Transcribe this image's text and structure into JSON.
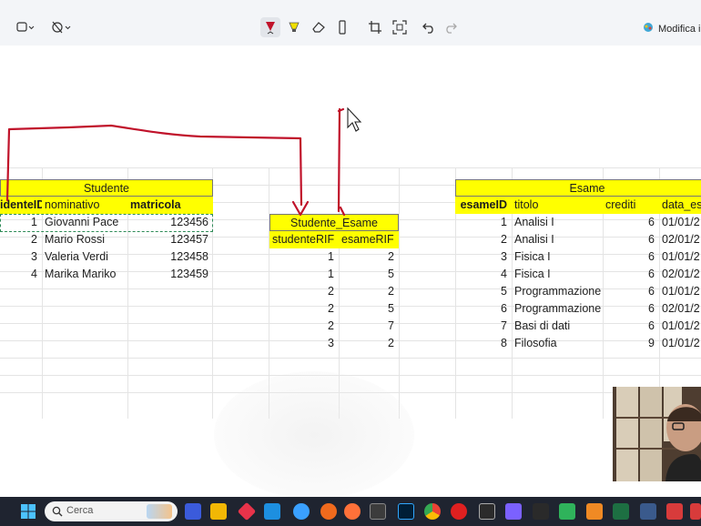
{
  "toolbar": {
    "modifica_label": "Modifica in",
    "tools": [
      "shape-icon",
      "timer-off-icon",
      "pen-icon",
      "highlighter-icon",
      "eraser-icon",
      "ruler-icon",
      "crop-icon",
      "text-extract-icon",
      "undo-icon",
      "redo-icon"
    ]
  },
  "studente": {
    "title": "Studente",
    "headers": [
      "identeID",
      "nominativo",
      "matricola"
    ],
    "rows": [
      {
        "id": "1",
        "nome": "Giovanni Pace",
        "matricola": "123456"
      },
      {
        "id": "2",
        "nome": "Mario Rossi",
        "matricola": "123457"
      },
      {
        "id": "3",
        "nome": "Valeria Verdi",
        "matricola": "123458"
      },
      {
        "id": "4",
        "nome": "Marika Mariko",
        "matricola": "123459"
      }
    ]
  },
  "studente_esame": {
    "title": "Studente_Esame",
    "headers": [
      "studenteRIF",
      "esameRIF"
    ],
    "rows": [
      [
        "1",
        "2"
      ],
      [
        "1",
        "5"
      ],
      [
        "2",
        "2"
      ],
      [
        "2",
        "5"
      ],
      [
        "2",
        "7"
      ],
      [
        "3",
        "2"
      ]
    ]
  },
  "esame": {
    "title": "Esame",
    "headers": [
      "esameID",
      "titolo",
      "crediti",
      "data_es"
    ],
    "rows": [
      {
        "id": "1",
        "titolo": "Analisi I",
        "crediti": "6",
        "data": "01/01/2"
      },
      {
        "id": "2",
        "titolo": "Analisi I",
        "crediti": "6",
        "data": "02/01/2"
      },
      {
        "id": "3",
        "titolo": "Fisica I",
        "crediti": "6",
        "data": "01/01/2"
      },
      {
        "id": "4",
        "titolo": "Fisica I",
        "crediti": "6",
        "data": "02/01/2"
      },
      {
        "id": "5",
        "titolo": "Programmazione",
        "crediti": "6",
        "data": "01/01/2"
      },
      {
        "id": "6",
        "titolo": "Programmazione",
        "crediti": "6",
        "data": "02/01/2"
      },
      {
        "id": "7",
        "titolo": "Basi di dati",
        "crediti": "6",
        "data": "01/01/2"
      },
      {
        "id": "8",
        "titolo": "Filosofia",
        "crediti": "9",
        "data": "01/01/2"
      }
    ]
  },
  "taskbar": {
    "search_placeholder": "Cerca"
  },
  "colors": {
    "header_yellow": "#ffff00",
    "annotation_red": "#c0122a",
    "taskbar": "#1f2430"
  }
}
